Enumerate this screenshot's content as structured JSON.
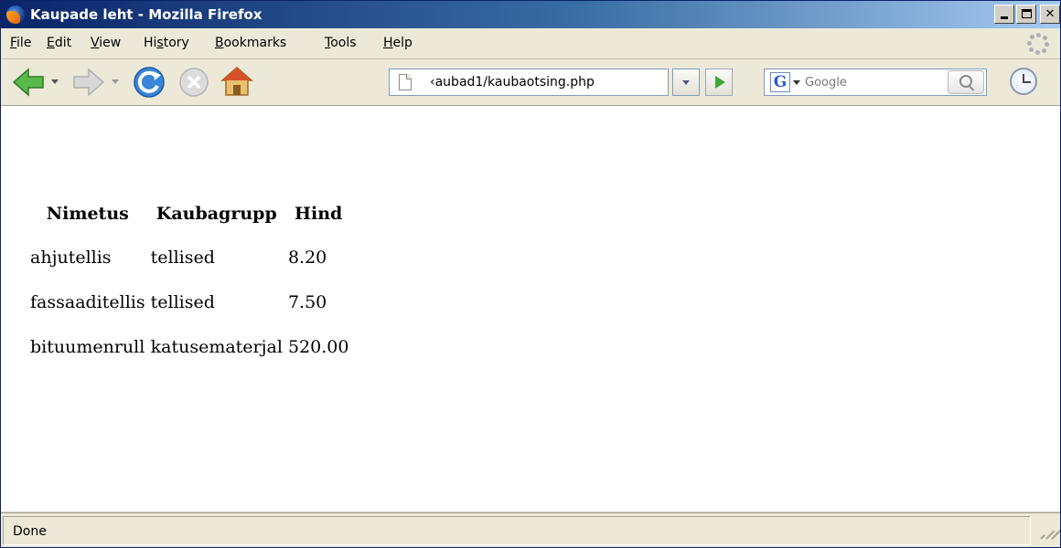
{
  "window": {
    "title": "Kaupade leht - Mozilla Firefox",
    "title_bar_color": "#0a246a"
  },
  "menu": {
    "items": [
      {
        "label_acc": "F",
        "label_rest": "ile"
      },
      {
        "label_acc": "E",
        "label_rest": "dit"
      },
      {
        "label_acc": "V",
        "label_rest": "iew"
      },
      {
        "label_pre": "Hi",
        "label_acc": "s",
        "label_rest": "tory"
      },
      {
        "label_acc": "B",
        "label_rest": "ookmarks"
      },
      {
        "label_acc": "T",
        "label_rest": "ools"
      },
      {
        "label_acc": "H",
        "label_rest": "elp"
      }
    ]
  },
  "toolbar": {
    "url": "‹aubad1/kaubaotsing.php",
    "search_engine_icon": "G",
    "search_placeholder": "Google",
    "icons": [
      "back-arrow-icon",
      "forward-arrow-icon",
      "reload-icon",
      "stop-icon",
      "home-icon",
      "page-icon",
      "go-icon",
      "google-icon",
      "search-icon",
      "clock-icon"
    ]
  },
  "table": {
    "headers": [
      "Nimetus",
      "Kaubagrupp",
      "Hind"
    ],
    "rows": [
      [
        "ahjutellis",
        "tellised",
        "8.20"
      ],
      [
        "fassaaditellis",
        "tellised",
        "7.50"
      ],
      [
        "bituumenrull",
        "katusematerjal",
        "520.00"
      ]
    ]
  },
  "status": {
    "text": "Done"
  }
}
